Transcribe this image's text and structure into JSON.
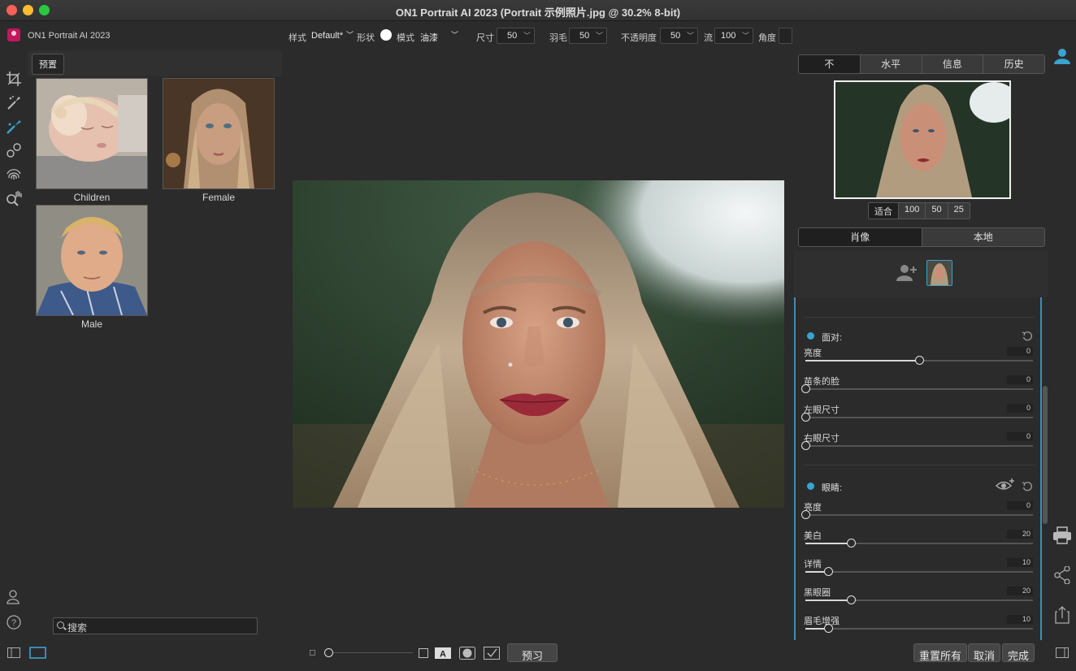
{
  "window": {
    "title": "ON1 Portrait AI 2023 (Portrait 示例照片.jpg @ 30.2% 8-bit)"
  },
  "toolbar": {
    "app_name": "ON1 Portrait AI 2023",
    "style_label": "样式",
    "style_value": "Default*",
    "shape_label": "形状",
    "mode_label": "模式",
    "mode_value": "油漆",
    "size_label": "尺寸",
    "size_value": "50",
    "feather_label": "羽毛",
    "feather_value": "50",
    "opacity_label": "不透明度",
    "opacity_value": "50",
    "flow_label": "流",
    "flow_value": "100",
    "angle_label": "角度"
  },
  "presets": {
    "button": "预置",
    "items": [
      {
        "caption": "Children"
      },
      {
        "caption": "Female"
      },
      {
        "caption": "Male"
      }
    ],
    "search_placeholder": "搜索"
  },
  "right_panel": {
    "top_tabs": [
      "不",
      "水平",
      "信息",
      "历史"
    ],
    "zoom_options": [
      "适合",
      "100",
      "50",
      "25"
    ],
    "mode_tabs": [
      "肖像",
      "本地"
    ],
    "face_section": {
      "title": "面对:",
      "sliders": [
        {
          "label": "亮度",
          "value": "0",
          "level": 0.5
        },
        {
          "label": "苗条的脸",
          "value": "0",
          "level": 0
        },
        {
          "label": "左眼尺寸",
          "value": "0",
          "level": 0
        },
        {
          "label": "右眼尺寸",
          "value": "0",
          "level": 0
        }
      ]
    },
    "eyes_section": {
      "title": "眼睛:",
      "sliders": [
        {
          "label": "亮度",
          "value": "0",
          "level": 0
        },
        {
          "label": "美白",
          "value": "20",
          "level": 0.2
        },
        {
          "label": "详情",
          "value": "10",
          "level": 0.1
        },
        {
          "label": "黑眼圈",
          "value": "20",
          "level": 0.2
        },
        {
          "label": "眉毛增强",
          "value": "10",
          "level": 0.1
        }
      ]
    }
  },
  "bottom": {
    "preview_label": "预习",
    "reset_all_label": "重置所有",
    "cancel_label": "取消",
    "done_label": "完成"
  },
  "colors": {
    "accent": "#3ba3cf",
    "background": "#2b2b2b"
  }
}
